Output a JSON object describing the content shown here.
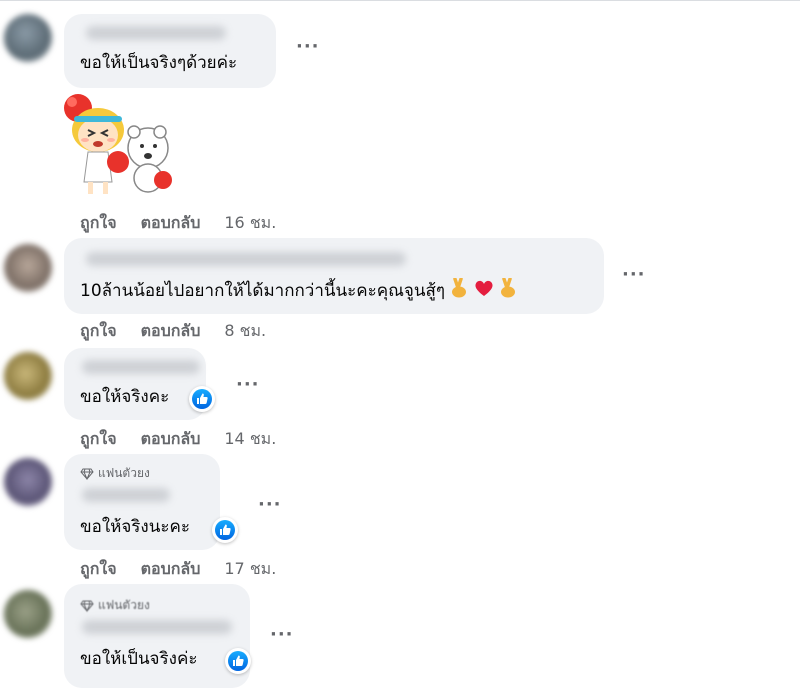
{
  "comments": [
    {
      "text": "ขอให้เป็นจริงๆด้วยค่ะ",
      "like_label": "ถูกใจ",
      "reply_label": "ตอบกลับ",
      "time": "16 ชม.",
      "sticker": "cheerleader-girl-and-bear-sticker"
    },
    {
      "text": "10ล้านน้อยไปอยากให้ได้มากกว่านี้นะคะคุณจูนสู้ๆ",
      "emojis": [
        "victory-hand-icon",
        "red-heart-icon",
        "victory-hand-icon"
      ],
      "like_label": "ถูกใจ",
      "reply_label": "ตอบกลับ",
      "time": "8 ชม."
    },
    {
      "text": "ขอให้จริงคะ",
      "like_label": "ถูกใจ",
      "reply_label": "ตอบกลับ",
      "time": "14 ชม.",
      "reaction": "like"
    },
    {
      "badge": "แฟนตัวยง",
      "text": "ขอให้จริงนะคะ",
      "like_label": "ถูกใจ",
      "reply_label": "ตอบกลับ",
      "time": "17 ชม.",
      "reaction": "like"
    },
    {
      "badge": "แฟนตัวยง",
      "text": "ขอให้เป็นจริงค่ะ",
      "reaction": "like"
    }
  ],
  "more_icon": "more-options-icon",
  "colors": {
    "bubble": "#f0f2f5",
    "secondary_text": "#65676b",
    "like_blue": "#0866ff",
    "heart_red": "#e41e3f"
  }
}
